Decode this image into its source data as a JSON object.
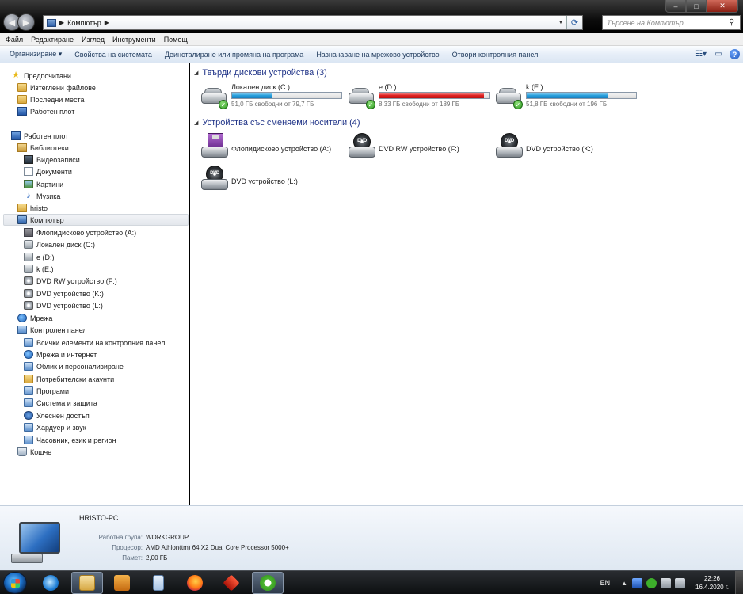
{
  "window": {
    "breadcrumb": [
      "Компютър"
    ],
    "search_placeholder": "Търсене на Компютър",
    "min_label": "‒",
    "max_label": "□",
    "close_label": "✕"
  },
  "menubar": [
    "Файл",
    "Редактиране",
    "Изглед",
    "Инструменти",
    "Помощ"
  ],
  "toolbar": {
    "items": [
      "Организиране ▾",
      "Свойства на системата",
      "Деинсталиране или промяна на програма",
      "Назначаване на мрежово устройство",
      "Отвори контролния панел"
    ]
  },
  "navpane": {
    "items": [
      {
        "label": "Предпочитани",
        "icon": "star-icon"
      },
      {
        "label": "Изтеглени файлове",
        "icon": "folder-icon"
      },
      {
        "label": "Последни места",
        "icon": "folder-icon"
      },
      {
        "label": "Работен плот",
        "icon": "desktop-icon"
      },
      {
        "label": "Работен плот",
        "icon": "desktop-icon"
      },
      {
        "label": "Библиотеки",
        "icon": "library-icon"
      },
      {
        "label": "Видеозаписи",
        "icon": "video-icon"
      },
      {
        "label": "Документи",
        "icon": "document-icon"
      },
      {
        "label": "Картини",
        "icon": "picture-icon"
      },
      {
        "label": "Музика",
        "icon": "music-icon"
      },
      {
        "label": "hristo",
        "icon": "user-folder-icon"
      },
      {
        "label": "Компютър",
        "icon": "computer-icon"
      },
      {
        "label": "Флопидисково устройство (A:)",
        "icon": "floppy-icon"
      },
      {
        "label": "Локален диск (C:)",
        "icon": "hdd-icon"
      },
      {
        "label": "e (D:)",
        "icon": "hdd-icon"
      },
      {
        "label": "k (E:)",
        "icon": "hdd-icon"
      },
      {
        "label": "DVD RW устройство (F:)",
        "icon": "dvd-icon"
      },
      {
        "label": "DVD устройство (K:)",
        "icon": "dvd-icon"
      },
      {
        "label": "DVD устройство (L:)",
        "icon": "dvd-icon"
      },
      {
        "label": "Мрежа",
        "icon": "network-icon"
      },
      {
        "label": "Контролен панел",
        "icon": "control-panel-icon"
      },
      {
        "label": "Всички елементи на контролния панел",
        "icon": "control-panel-icon"
      },
      {
        "label": "Мрежа и интернет",
        "icon": "network-icon"
      },
      {
        "label": "Облик и персонализиране",
        "icon": "control-panel-icon"
      },
      {
        "label": "Потребителски акаунти",
        "icon": "user-icon"
      },
      {
        "label": "Програми",
        "icon": "control-panel-icon"
      },
      {
        "label": "Система и защита",
        "icon": "control-panel-icon"
      },
      {
        "label": "Улеснен достъп",
        "icon": "accessibility-icon"
      },
      {
        "label": "Хардуер и звук",
        "icon": "control-panel-icon"
      },
      {
        "label": "Часовник, език и регион",
        "icon": "control-panel-icon"
      },
      {
        "label": "Кошче",
        "icon": "recycle-bin-icon"
      }
    ]
  },
  "content": {
    "hdd_group": "Твърди дискови устройства (3)",
    "removable_group": "Устройства със сменяеми носители (4)",
    "hard_drives": [
      {
        "name": "Локален диск (C:)",
        "free": "51,0 ГБ свободни от 79,7 ГБ",
        "used_fraction": 0.36,
        "state": "normal"
      },
      {
        "name": "e (D:)",
        "free": "8,33 ГБ свободни от 189 ГБ",
        "used_fraction": 0.956,
        "state": "full"
      },
      {
        "name": "k (E:)",
        "free": "51,8 ГБ свободни от 196 ГБ",
        "used_fraction": 0.736,
        "state": "normal"
      }
    ],
    "removable": [
      {
        "name": "Флопидисково устройство (A:)",
        "kind": "floppy"
      },
      {
        "name": "DVD RW устройство (F:)",
        "kind": "dvd"
      },
      {
        "name": "DVD устройство (K:)",
        "kind": "dvd"
      },
      {
        "name": "DVD устройство (L:)",
        "kind": "dvd"
      }
    ],
    "dvd_badge": "DVD"
  },
  "details": {
    "pc_name": "HRISTO-PC",
    "workgroup_label": "Работна група:",
    "workgroup": "WORKGROUP",
    "cpu_label": "Процесор:",
    "cpu": "AMD Athlon(tm) 64 X2 Dual Core Processor 5000+",
    "memory_label": "Памет:",
    "memory": "2,00 ГБ"
  },
  "taskbar": {
    "apps": [
      "internet-explorer-icon",
      "file-explorer-icon",
      "media-player-icon",
      "notepad-icon",
      "firefox-icon",
      "app-icon",
      "utorrent-icon"
    ],
    "lang": "EN",
    "time": "22:26",
    "date": "16.4.2020 г."
  },
  "colors": {
    "bar_normal": "#27a0dd",
    "bar_full": "#e02020",
    "group_header": "#1e3287"
  }
}
